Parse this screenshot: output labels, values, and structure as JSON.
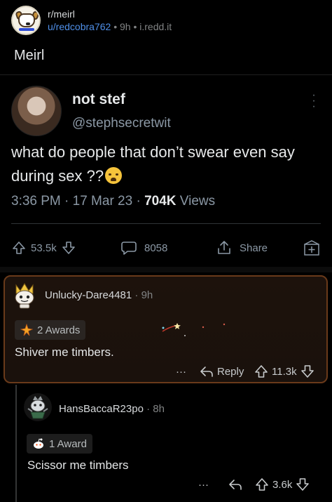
{
  "post": {
    "subreddit": "r/meirl",
    "username": "u/redcobra762",
    "age": "9h",
    "domain": "i.redd.it",
    "separator": "•",
    "title": "Meirl"
  },
  "tweet": {
    "display_name": "not stef",
    "handle": "@stephsecretwit",
    "text": "what do people that don’t swear even say during sex ??",
    "emoji": "crying-face-emoji",
    "timestamp": "3:36 PM · 17 Mar 23 · ",
    "views_count": "704K",
    "views_label": " Views",
    "likes": "53.5k",
    "comments": "8058",
    "share_label": "Share"
  },
  "comments": [
    {
      "username": "Unlucky-Dare4481",
      "age": "9h",
      "awards": "2 Awards",
      "body": "Shiver me timbers.",
      "more": "···",
      "reply_label": "Reply",
      "score": "11.3k",
      "highlight_color": "#6a3a1a"
    },
    {
      "username": "HansBaccaR23po",
      "age": "8h",
      "awards": "1 Award",
      "body": "Scissor me timbers",
      "more": "···",
      "score": "3.6k"
    }
  ],
  "colors": {
    "background": "#000000",
    "link_blue": "#4f8fe8",
    "muted": "#818384",
    "text": "#d7dadc"
  }
}
